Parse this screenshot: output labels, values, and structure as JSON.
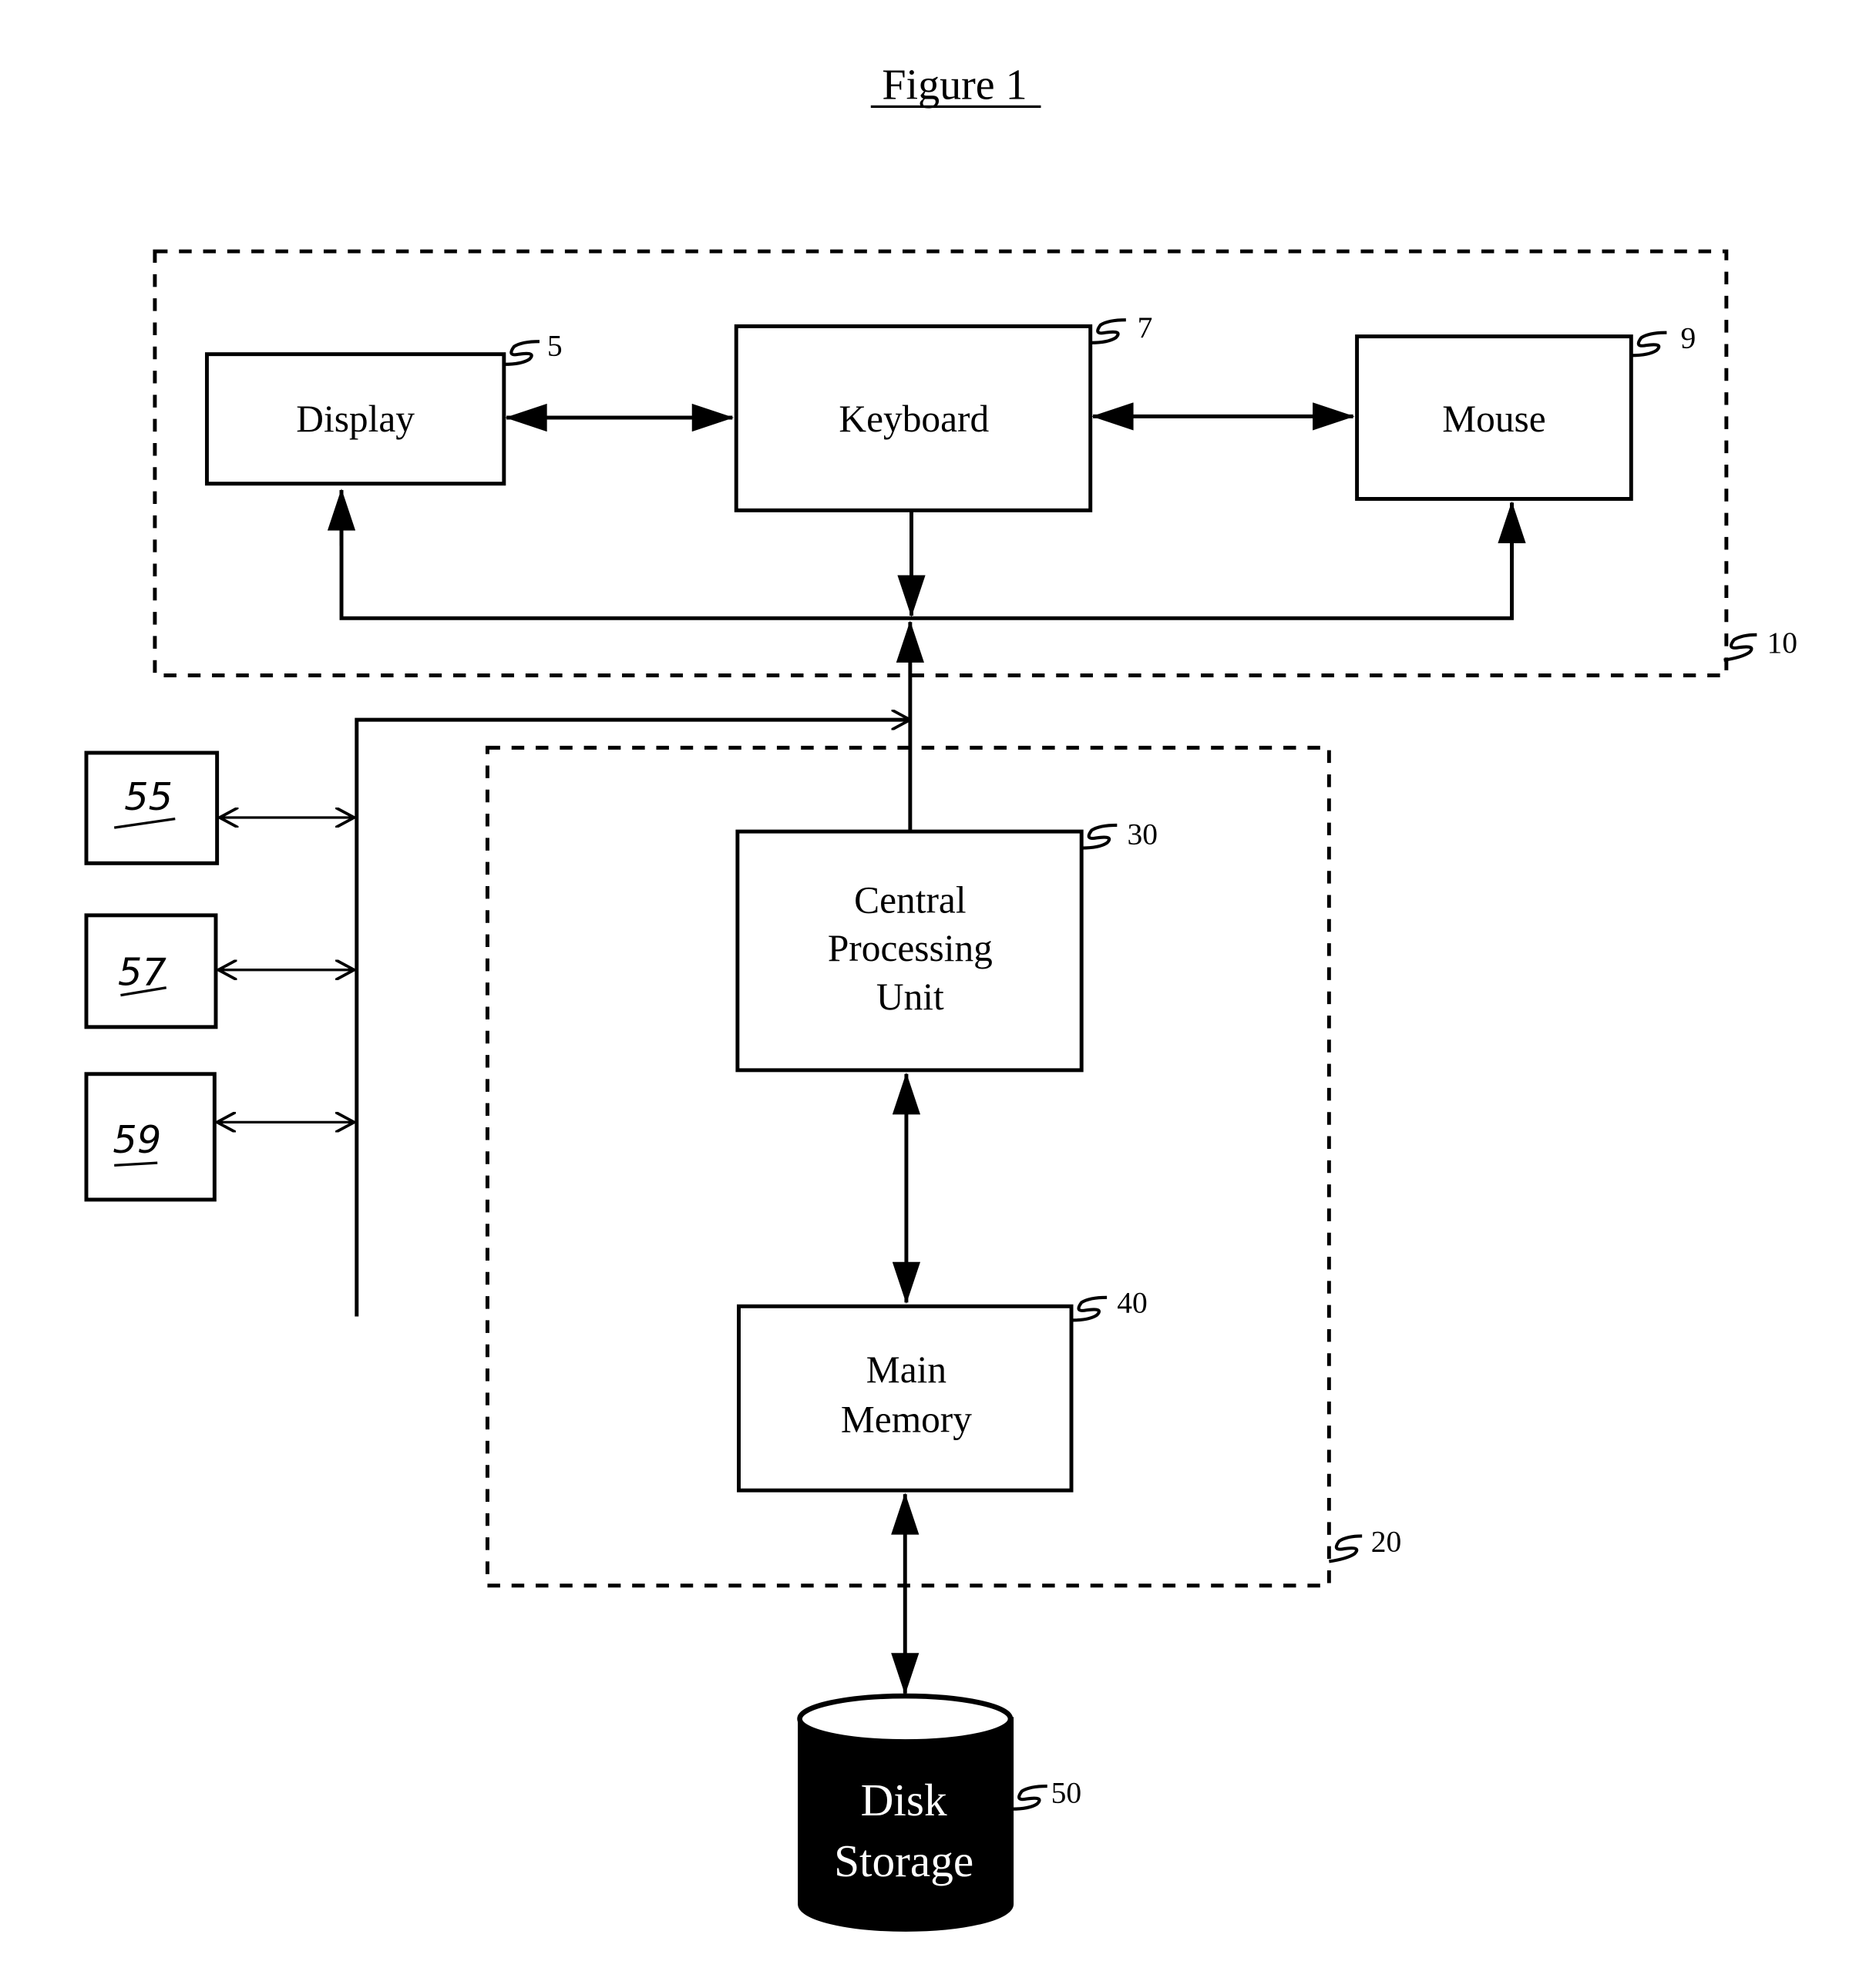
{
  "figure": {
    "title": "Figure 1"
  },
  "groups": {
    "input_output": {
      "ref": "10"
    },
    "computer": {
      "ref": "20"
    }
  },
  "components": {
    "display": {
      "label": "Display",
      "ref": "5"
    },
    "keyboard": {
      "label": "Keyboard",
      "ref": "7"
    },
    "mouse": {
      "label": "Mouse",
      "ref": "9"
    },
    "cpu": {
      "lines": [
        "Central",
        "Processing",
        "Unit"
      ],
      "ref": "30"
    },
    "memory": {
      "lines": [
        "Main",
        "Memory"
      ],
      "ref": "40"
    },
    "disk": {
      "lines": [
        "Disk",
        "Storage"
      ],
      "ref": "50"
    }
  },
  "peripherals": [
    {
      "label": "55"
    },
    {
      "label": "57"
    },
    {
      "label": "59"
    }
  ]
}
